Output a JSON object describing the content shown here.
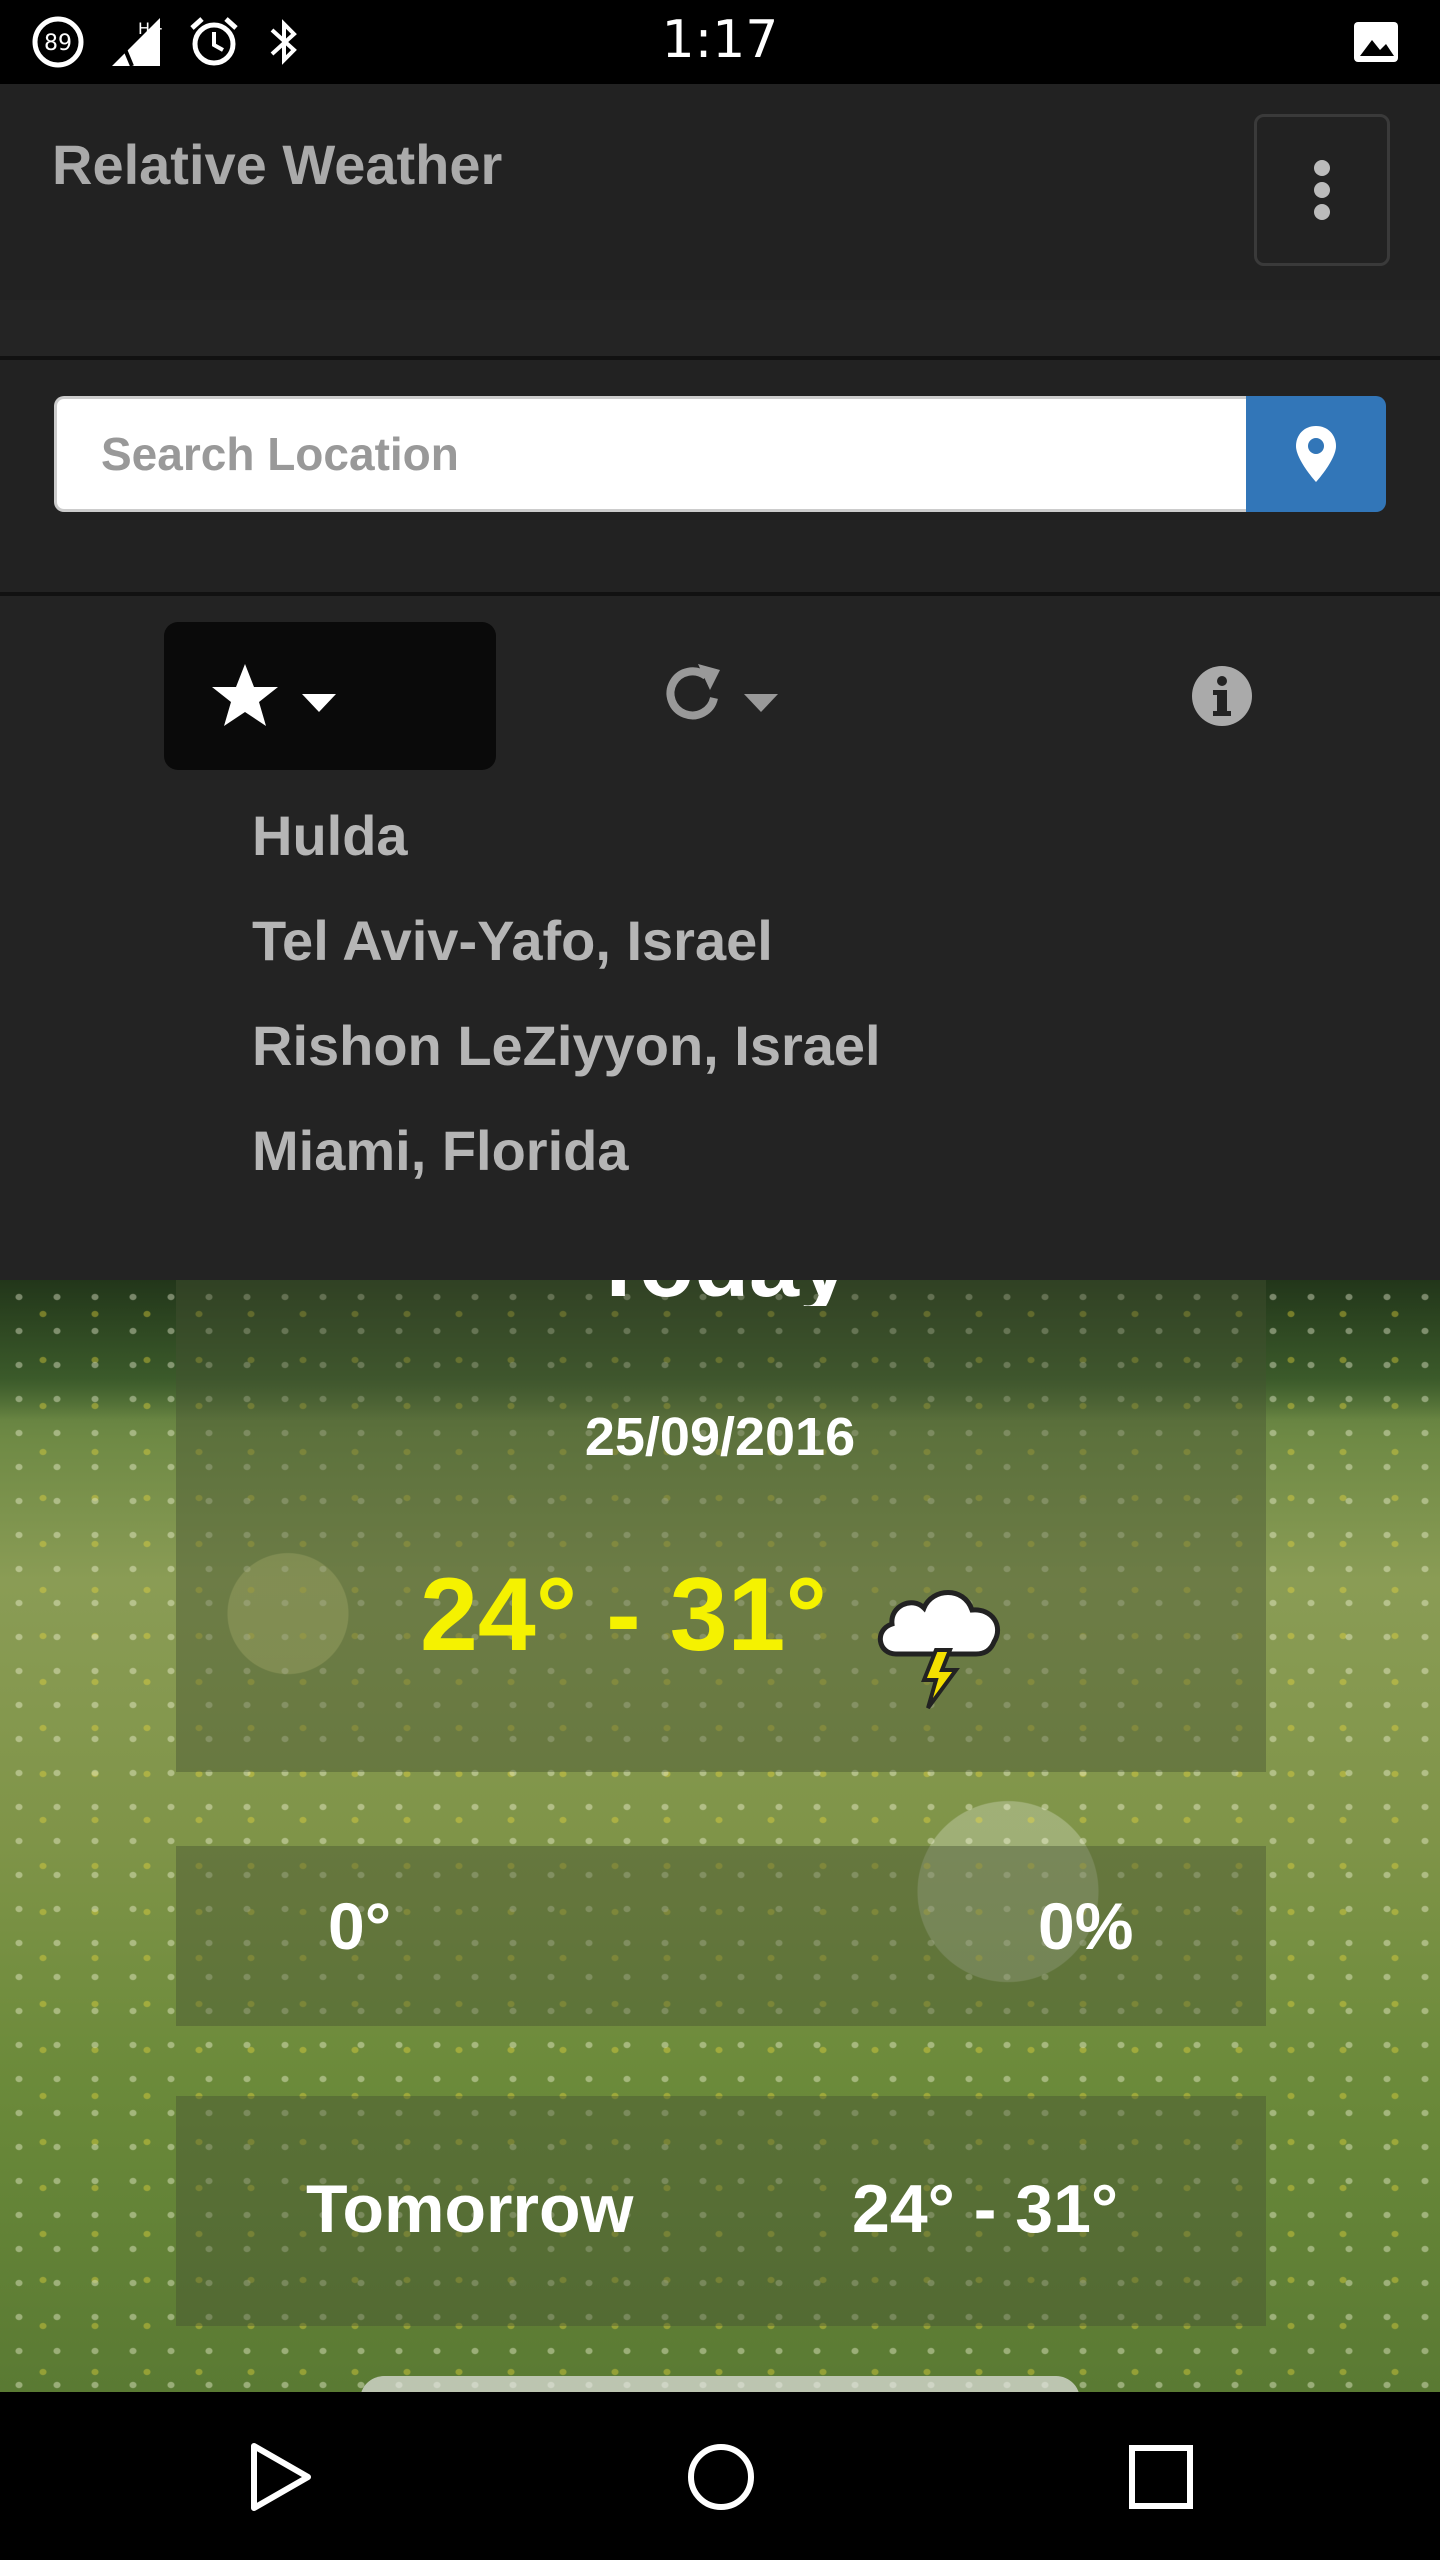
{
  "status_bar": {
    "time": "1:17",
    "battery_level": "89",
    "network_label": "H+",
    "icons": [
      "battery-icon",
      "signal-icon",
      "alarm-icon",
      "bluetooth-icon",
      "image-icon"
    ]
  },
  "app": {
    "title": "Relative Weather",
    "menu_icon": "more-vert-icon"
  },
  "search": {
    "placeholder": "Search Location",
    "value": "",
    "button_icon": "map-marker-icon"
  },
  "toolbar": {
    "favorites_icon": "star-icon",
    "refresh_icon": "refresh-icon",
    "info_icon": "info-icon"
  },
  "favorites": [
    "Hulda",
    "Tel Aviv-Yafo, Israel",
    "Rishon LeZiyyon, Israel",
    "Miami, Florida"
  ],
  "today": {
    "label": "Today",
    "date": "25/09/2016",
    "temp_range": "24° - 31°",
    "condition_icon": "thunderstorm-icon",
    "wind": "0°",
    "precipitation": "0%"
  },
  "tomorrow": {
    "label": "Tomorrow",
    "temp_range": "24° - 31°"
  },
  "colors": {
    "accent": "#3276b8",
    "temperature": "#f5f200",
    "background": "#222222"
  },
  "nav_bar": {
    "icons": [
      "back-icon",
      "home-icon",
      "recents-icon"
    ]
  }
}
